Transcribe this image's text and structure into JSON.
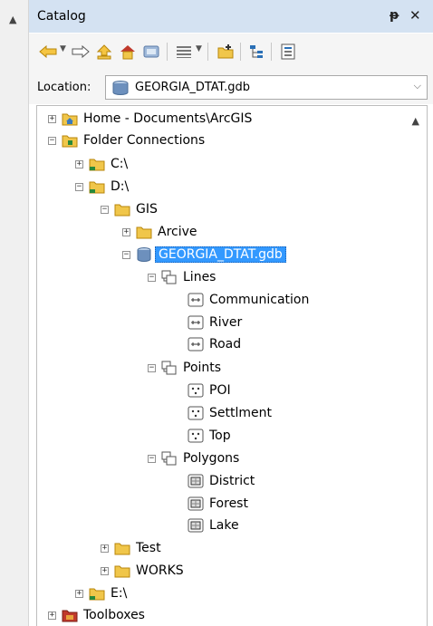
{
  "panel": {
    "title": "Catalog",
    "pin": "ᵱ",
    "close": "✕"
  },
  "location": {
    "label": "Location:",
    "value": "GEORGIA_DTAT.gdb"
  },
  "tree": {
    "home": "Home - Documents\\ArcGIS",
    "folder_connections": "Folder Connections",
    "c": "C:\\",
    "d": "D:\\",
    "gis": "GIS",
    "arcive": "Arcive",
    "gdb": "GEORGIA_DTAT.gdb",
    "lines": "Lines",
    "communication": "Communication",
    "river": "River",
    "road": "Road",
    "points": "Points",
    "poi": "POI",
    "settlment": "Settlment",
    "top": "Top",
    "polygons": "Polygons",
    "district": "District",
    "forest": "Forest",
    "lake": "Lake",
    "test": "Test",
    "works": "WORKS",
    "e": "E:\\",
    "toolboxes": "Toolboxes"
  },
  "colors": {
    "titlebar": "#d4e2f2",
    "selection": "#3399ff",
    "folder": "#f0c64a"
  },
  "icons": [
    "back-icon",
    "forward-icon",
    "up-one-level-icon",
    "home-icon",
    "connect-folder-icon",
    "views-icon",
    "new-geodatabase-icon",
    "toggle-tree-icon",
    "options-icon"
  ]
}
